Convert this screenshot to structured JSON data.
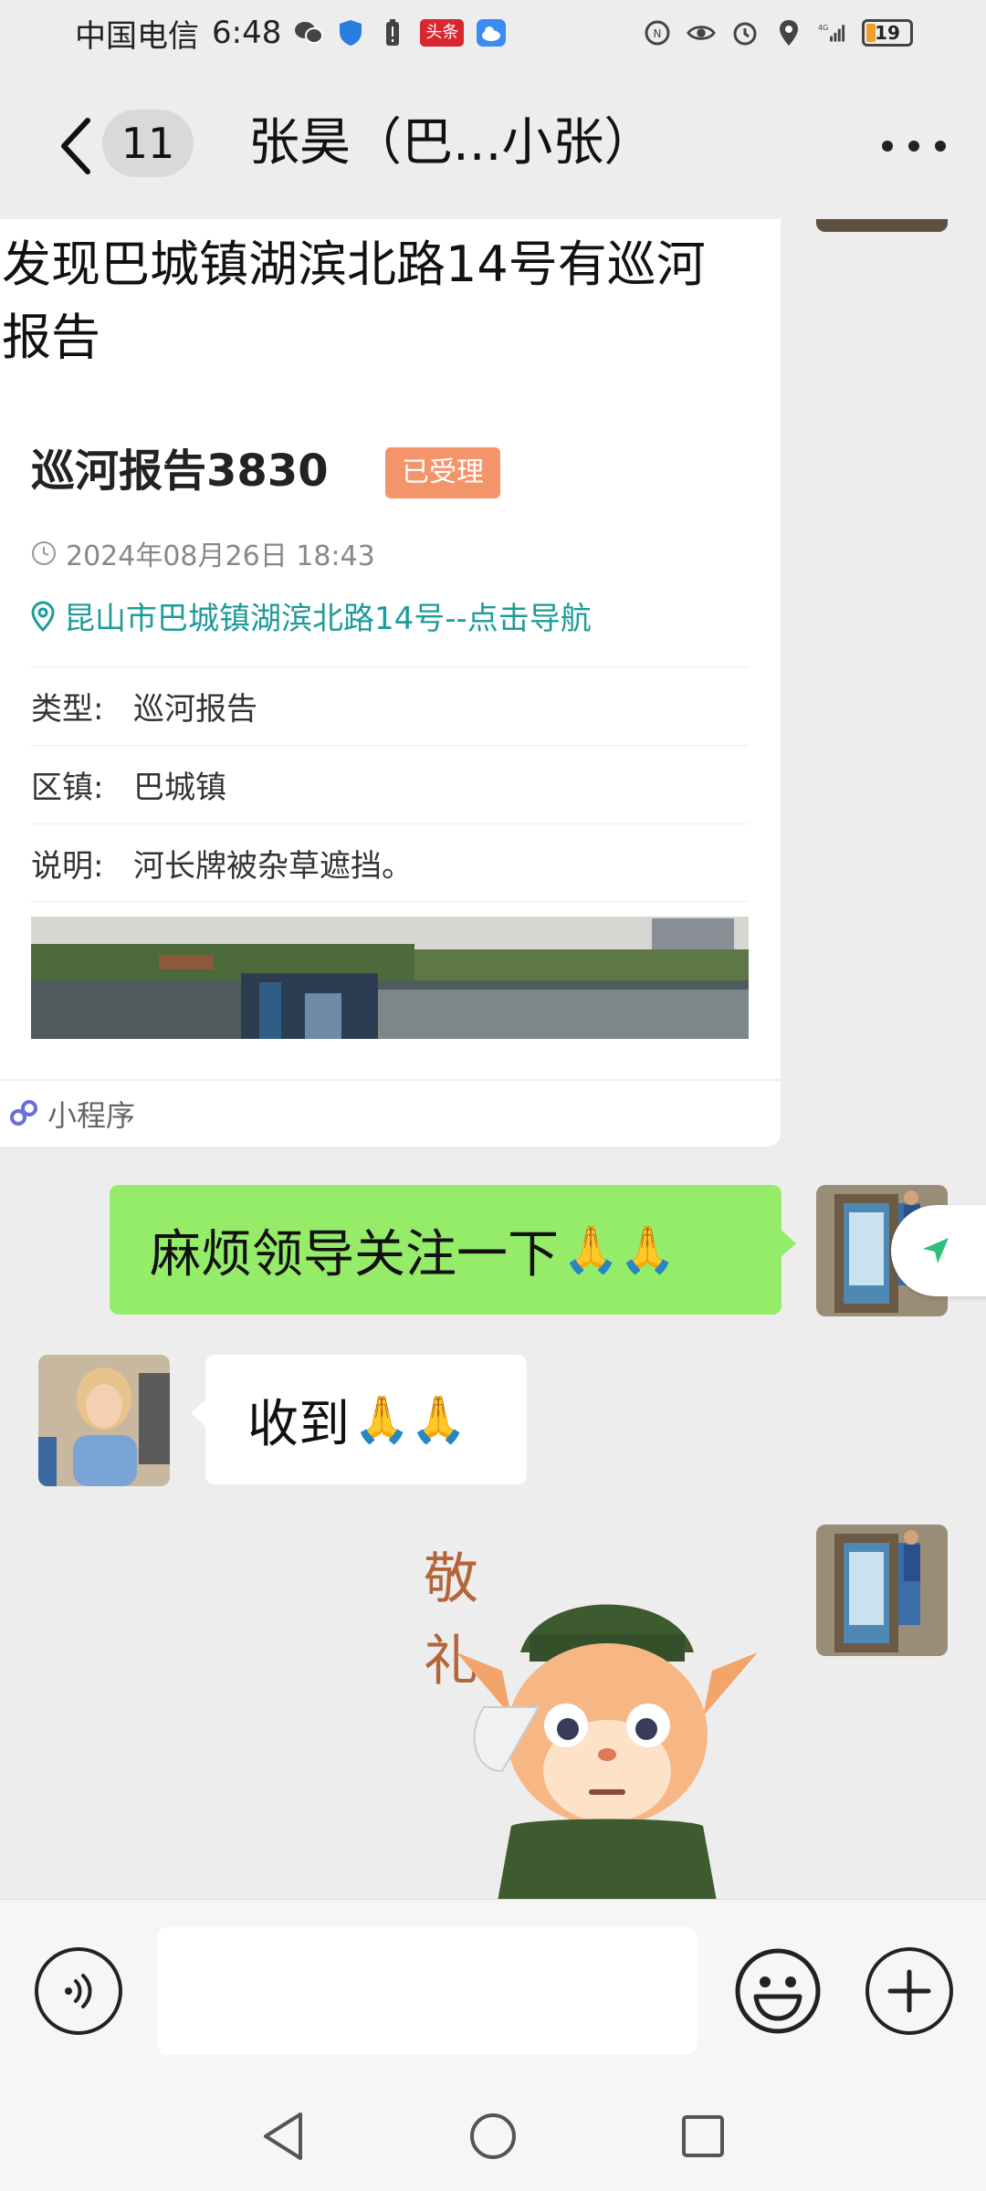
{
  "status_bar": {
    "carrier": "中国电信",
    "time": "6:48",
    "badge": "头条",
    "network": "4G",
    "battery": "19"
  },
  "header": {
    "unread_count": "11",
    "title": "张昊（巴...小张）"
  },
  "mini_program_card": {
    "headline": "发现巴城镇湖滨北路14号有巡河报告",
    "report_title": "巡河报告3830",
    "status": "已受理",
    "datetime": "2024年08月26日 18:43",
    "location": "昆山市巴城镇湖滨北路14号--点击导航",
    "fields": [
      {
        "label": "类型:",
        "value": "巡河报告"
      },
      {
        "label": "区镇:",
        "value": "巴城镇"
      },
      {
        "label": "说明:",
        "value": "河长牌被杂草遮挡。"
      }
    ],
    "footer_label": "小程序"
  },
  "messages": {
    "outgoing_text": "麻烦领导关注一下",
    "incoming_text": "收到",
    "emoji": "🙏🙏"
  },
  "sticker": {
    "text_line1": "敬",
    "text_line2": "礼"
  },
  "input": {
    "placeholder": ""
  },
  "colors": {
    "outgoing_bubble": "#95ec69",
    "status_tag": "#f4946b",
    "location_link": "#1e9b9a",
    "background": "#ededed"
  }
}
